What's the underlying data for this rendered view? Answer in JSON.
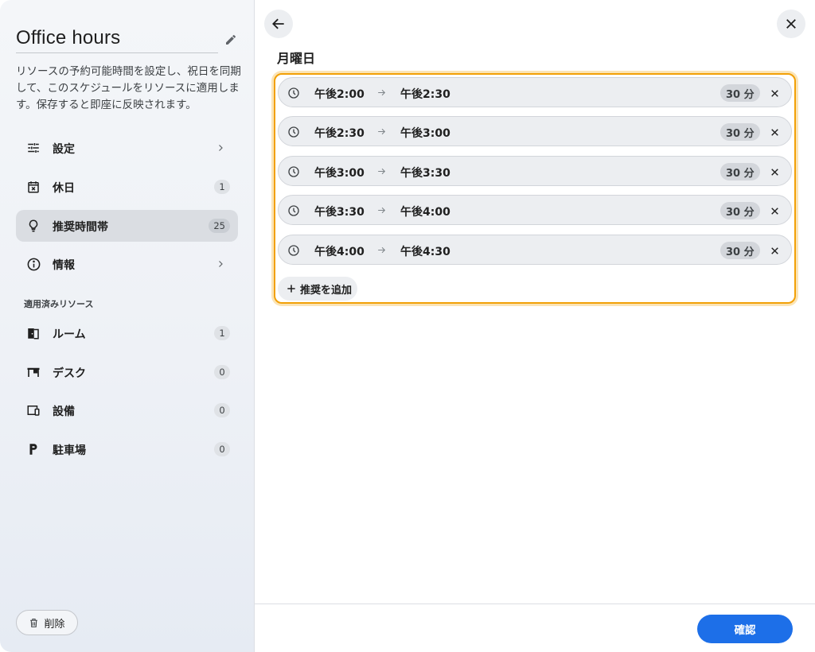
{
  "sidebar": {
    "title": "Office hours",
    "description": "リソースの予約可能時間を設定し、祝日を同期して、このスケジュールをリソースに適用します。保存すると即座に反映されます。",
    "nav": [
      {
        "label": "設定",
        "icon": "sliders-icon",
        "badge": null,
        "chevron": true,
        "active": false
      },
      {
        "label": "休日",
        "icon": "calendar-x-icon",
        "badge": "1",
        "chevron": false,
        "active": false
      },
      {
        "label": "推奨時間帯",
        "icon": "lightbulb-icon",
        "badge": "25",
        "chevron": false,
        "active": true
      },
      {
        "label": "情報",
        "icon": "info-icon",
        "badge": null,
        "chevron": true,
        "active": false
      }
    ],
    "resources_label": "適用済みリソース",
    "resources": [
      {
        "label": "ルーム",
        "icon": "room-door-icon",
        "badge": "1"
      },
      {
        "label": "デスク",
        "icon": "desk-icon",
        "badge": "0"
      },
      {
        "label": "設備",
        "icon": "devices-icon",
        "badge": "0"
      },
      {
        "label": "駐車場",
        "icon": "parking-icon",
        "badge": "0"
      }
    ],
    "delete_label": "削除"
  },
  "main": {
    "day_title": "月曜日",
    "slots": [
      {
        "start": "午後2:00",
        "end": "午後2:30",
        "duration": "30 分"
      },
      {
        "start": "午後2:30",
        "end": "午後3:00",
        "duration": "30 分"
      },
      {
        "start": "午後3:00",
        "end": "午後3:30",
        "duration": "30 分"
      },
      {
        "start": "午後3:30",
        "end": "午後4:00",
        "duration": "30 分"
      },
      {
        "start": "午後4:00",
        "end": "午後4:30",
        "duration": "30 分"
      }
    ],
    "add_label": "推奨を追加",
    "confirm_label": "確認"
  },
  "colors": {
    "accent": "#1d6fe8",
    "highlight_border": "#f2a007",
    "active_nav": "#dadde2"
  }
}
